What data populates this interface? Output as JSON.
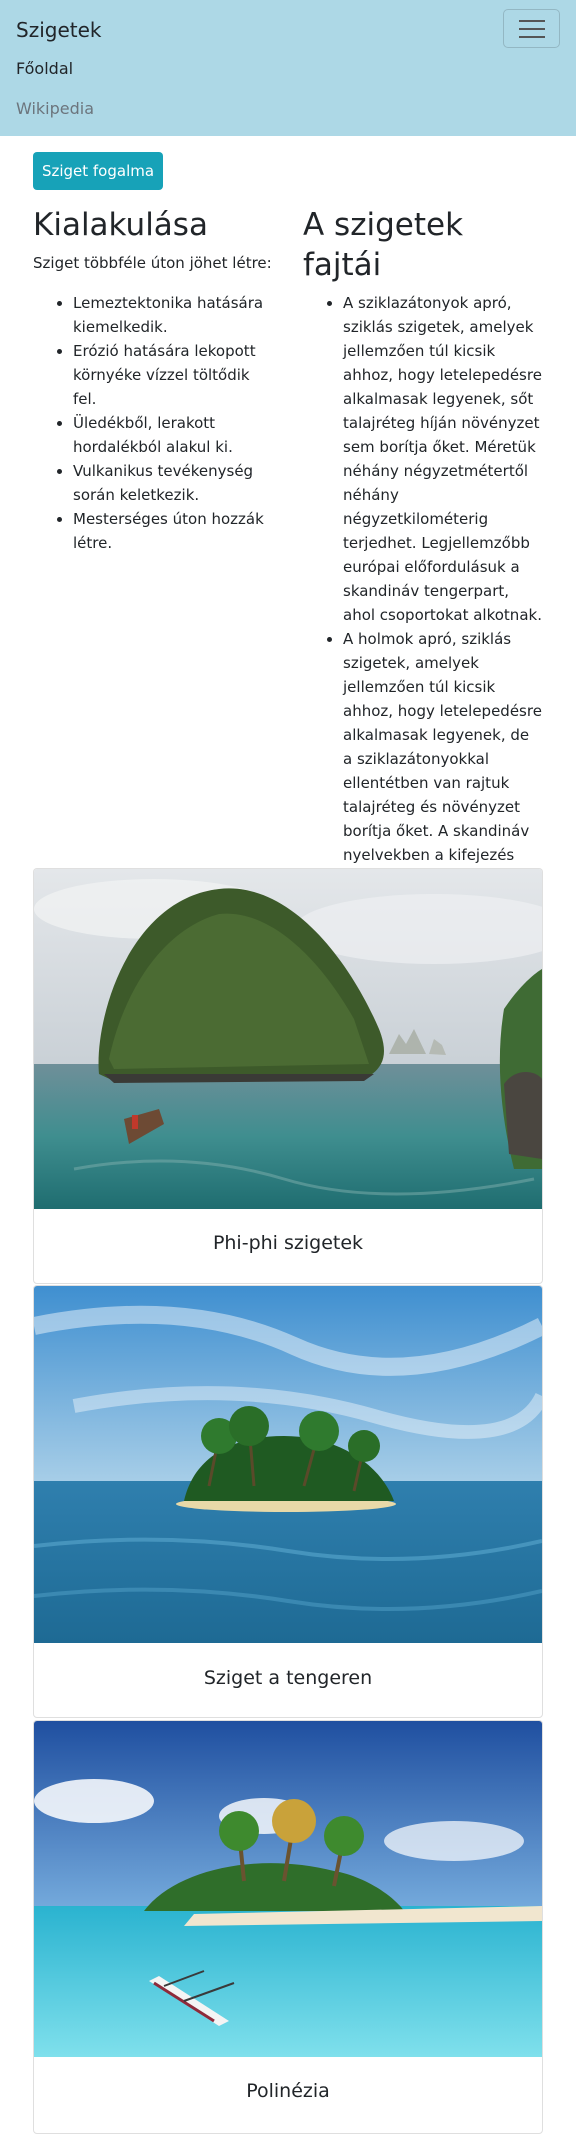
{
  "navbar": {
    "brand": "Szigetek",
    "links": [
      "Főoldal",
      "Wikipedia"
    ],
    "toggle_icon": "hamburger-menu-icon"
  },
  "button": {
    "label": "Sziget fogalma"
  },
  "left": {
    "heading": "Kialakulása",
    "intro": "Sziget többféle úton jöhet létre:",
    "items": [
      "Lemeztektonika hatására kiemelkedik.",
      "Erózió hatására lekopott környéke vízzel töltődik fel.",
      "Üledékből, lerakott hordalékból alakul ki.",
      "Vulkanikus tevékenység során keletkezik.",
      "Mesterséges úton hozzák létre."
    ]
  },
  "right": {
    "heading": "A szigetek fajtái",
    "items": [
      "A sziklazátonyok apró, sziklás szigetek, amelyek jellemzően túl kicsik ahhoz, hogy letelepedésre alkalmasak legyenek, sőt talajréteg híján növényzet sem borítja őket. Méretük néhány négyzetmétertől néhány négyzetkilométerig terjedhet. Legjellemzőbb európai előfordulásuk a skandináv tengerpart, ahol csoportokat alkotnak.",
      "A holmok apró, sziklás szigetek, amelyek jellemzően túl kicsik ahhoz, hogy letelepedésre alkalmasak legyenek, de a sziklazátonyokkal ellentétben van rajtuk talajréteg és növényzet borítja őket. A skandináv nyelvekben a kifejezés kicsi, legfeljebb közepes méretű szigetet jelent."
    ]
  },
  "cards": [
    {
      "caption": "Phi-phi szigetek"
    },
    {
      "caption": "Sziget a tengeren"
    },
    {
      "caption": "Polinézia"
    }
  ],
  "colors": {
    "navbar_bg": "#add8e6",
    "button_bg": "#17a2b8"
  }
}
